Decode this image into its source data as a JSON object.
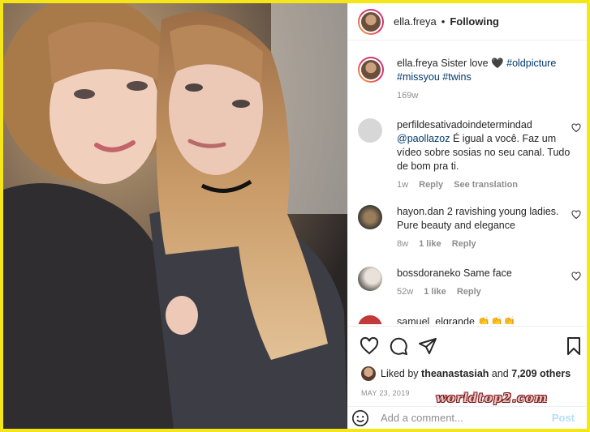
{
  "post": {
    "username": "ella.freya",
    "follow_status": "Following",
    "separator": "•",
    "caption": {
      "user": "ella.freya",
      "text": "Sister love",
      "emoji": "🖤",
      "tags": [
        "#oldpicture",
        "#missyou",
        "#twins"
      ]
    },
    "caption_age": "169w"
  },
  "comments": [
    {
      "user": "perfildesativadoindetermindad",
      "mention": "@paollazoz",
      "text": "É igual a você. Faz um vídeo sobre sosias no seu canal. Tudo de bom pra ti.",
      "age": "1w",
      "likes": "",
      "reply": "Reply",
      "translate": "See translation"
    },
    {
      "user": "hayon.dan",
      "text": "2 ravishing young ladies. Pure beauty and elegance",
      "age": "8w",
      "likes": "1 like",
      "reply": "Reply"
    },
    {
      "user": "bossdoraneko",
      "text": "Same face",
      "age": "52w",
      "likes": "1 like",
      "reply": "Reply"
    },
    {
      "user": "samuel_elgrande",
      "text": "👏👏👏"
    }
  ],
  "likes": {
    "prefix": "Liked by",
    "user": "theanastasiah",
    "and": "and",
    "others": "7,209 others"
  },
  "date": "MAY 23, 2019",
  "watermark": "worldtop2.com",
  "add_comment": {
    "placeholder": "Add a comment...",
    "post_label": "Post"
  },
  "colors": {
    "border": "#f5e61a",
    "link": "#00376b",
    "post_disabled": "#b2dffc"
  },
  "icons": [
    "heart-icon",
    "comment-icon",
    "share-icon",
    "save-icon",
    "emoji-icon"
  ]
}
